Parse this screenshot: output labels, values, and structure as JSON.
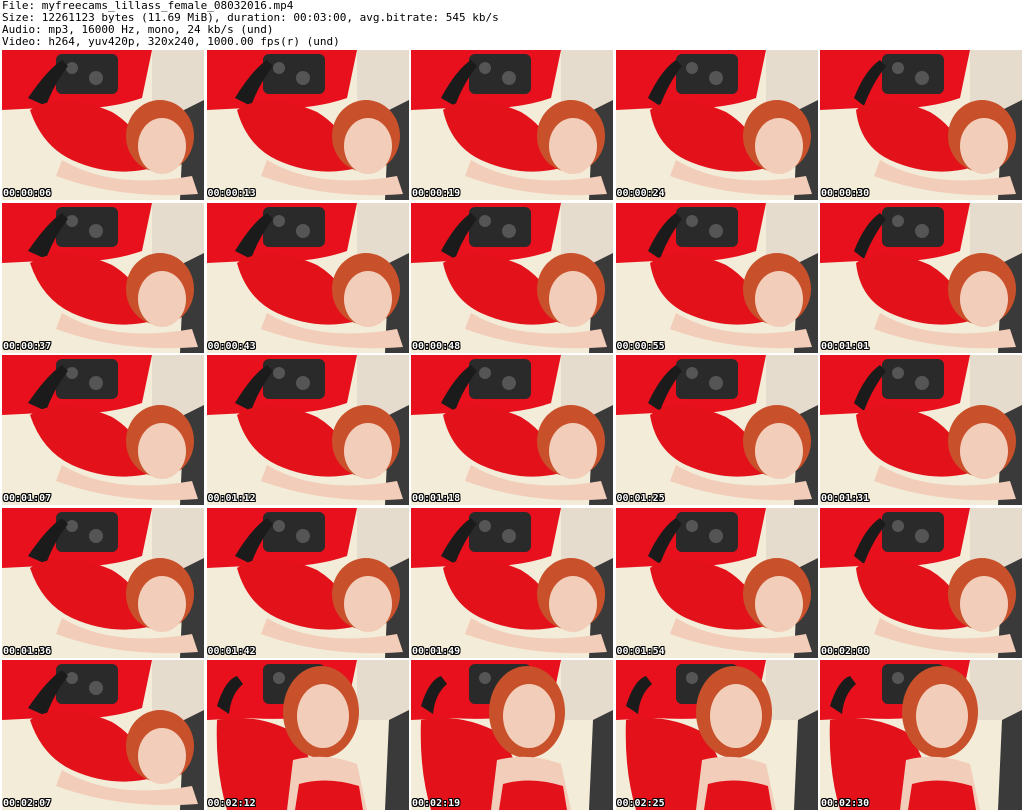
{
  "header": {
    "line1": "File: myfreecams_lillass_female_08032016.mp4",
    "line2": "Size: 12261123 bytes (11.69 MiB), duration: 00:03:00, avg.bitrate: 545 kb/s",
    "line3": "Audio: mp3, 16000 Hz, mono, 24 kb/s (und)",
    "line4": "Video: h264, yuv420p, 320x240, 1000.00 fps(r) (und)"
  },
  "colors": {
    "red_wall": "#e8101c",
    "dress": "#e3121a",
    "bedding": "#f3ecd9",
    "hair": "#c8502a",
    "skin": "#f2cdb9",
    "pillow": "#2a2a2a"
  },
  "thumbnails": [
    {
      "timestamp": "00:00:06",
      "pose": "lying"
    },
    {
      "timestamp": "00:00:13",
      "pose": "lying"
    },
    {
      "timestamp": "00:00:19",
      "pose": "lying"
    },
    {
      "timestamp": "00:00:24",
      "pose": "lying"
    },
    {
      "timestamp": "00:00:30",
      "pose": "lying"
    },
    {
      "timestamp": "00:00:37",
      "pose": "lying"
    },
    {
      "timestamp": "00:00:43",
      "pose": "lying"
    },
    {
      "timestamp": "00:00:48",
      "pose": "lying"
    },
    {
      "timestamp": "00:00:55",
      "pose": "lying"
    },
    {
      "timestamp": "00:01:01",
      "pose": "lying"
    },
    {
      "timestamp": "00:01:07",
      "pose": "lying"
    },
    {
      "timestamp": "00:01:12",
      "pose": "lying"
    },
    {
      "timestamp": "00:01:18",
      "pose": "lying"
    },
    {
      "timestamp": "00:01:25",
      "pose": "lying"
    },
    {
      "timestamp": "00:01:31",
      "pose": "lying"
    },
    {
      "timestamp": "00:01:36",
      "pose": "lying"
    },
    {
      "timestamp": "00:01:42",
      "pose": "lying"
    },
    {
      "timestamp": "00:01:49",
      "pose": "lying"
    },
    {
      "timestamp": "00:01:54",
      "pose": "lying"
    },
    {
      "timestamp": "00:02:00",
      "pose": "lying"
    },
    {
      "timestamp": "00:02:07",
      "pose": "lying"
    },
    {
      "timestamp": "00:02:12",
      "pose": "upright"
    },
    {
      "timestamp": "00:02:19",
      "pose": "upright"
    },
    {
      "timestamp": "00:02:25",
      "pose": "upright"
    },
    {
      "timestamp": "00:02:30",
      "pose": "upright"
    }
  ]
}
